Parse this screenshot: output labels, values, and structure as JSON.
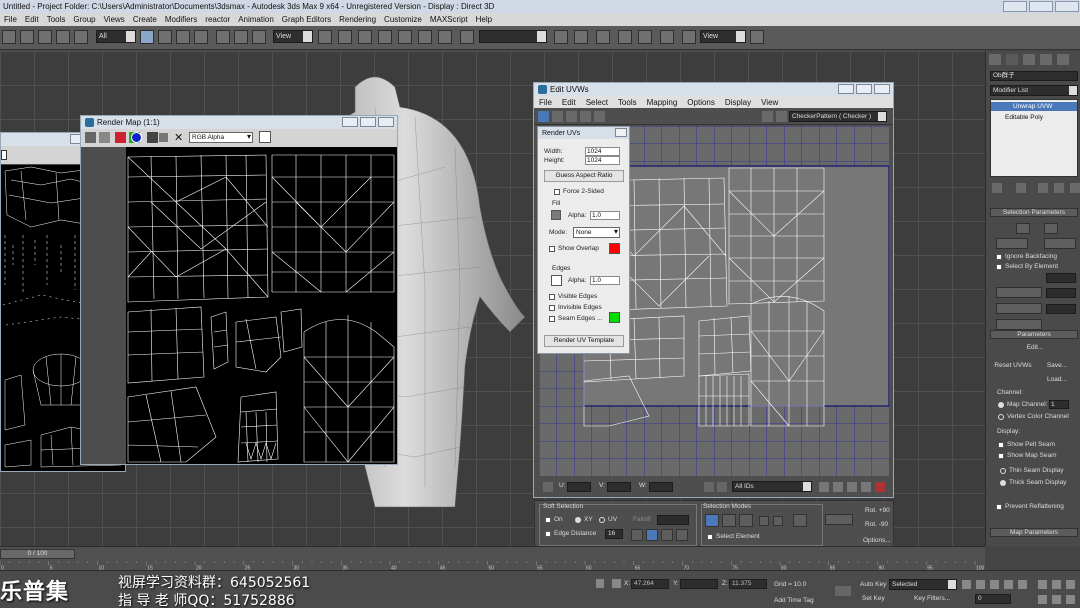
{
  "titlebar": {
    "text": "Untitled      - Project Folder: C:\\Users\\Administrator\\Documents\\3dsmax      - Autodesk 3ds Max 9 x64    - Unregistered Version      - Display : Direct 3D"
  },
  "menubar": [
    "File",
    "Edit",
    "Tools",
    "Group",
    "Views",
    "Create",
    "Modifiers",
    "reactor",
    "Animation",
    "Graph Editors",
    "Rendering",
    "Customize",
    "MAXScript",
    "Help"
  ],
  "toolbar": {
    "selection_filter": "All",
    "ref_coord": "View",
    "named_set": "",
    "view_dropdown": "View"
  },
  "render_map": {
    "title": "Render Map (1:1)",
    "channel": "RGB Alpha"
  },
  "edit_uvws": {
    "title": "Edit UVWs",
    "menu": [
      "File",
      "Edit",
      "Select",
      "Tools",
      "Mapping",
      "Options",
      "Display",
      "View"
    ],
    "map_dropdown": "CheckerPattern  ( Checker )",
    "status": {
      "u_label": "U:",
      "v_label": "V:",
      "w_label": "W:",
      "ids": "All IDs"
    }
  },
  "render_uvs": {
    "title": "Render UVs",
    "width_label": "Width:",
    "width": "1024",
    "height_label": "Height:",
    "height": "1024",
    "guess_aspect": "Guess Aspect Ratio",
    "force_2sided": "Force 2-Sided",
    "fill_header": "Fill",
    "alpha_label": "Alpha:",
    "fill_alpha": "1.0",
    "mode_label": "Mode:",
    "mode": "None",
    "show_overlap": "Show Overlap",
    "edges_header": "Edges",
    "edge_alpha": "1.0",
    "visible_edges": "Visible Edges",
    "invisible_edges": "Invisible Edges",
    "seam_edges": "Seam Edges ...",
    "render_template": "Render UV Template",
    "colors": {
      "fill": "#7a7a7a",
      "overlap": "#ff0000",
      "edge": "#ffffff",
      "seam": "#00e000"
    }
  },
  "uvw_bottom": {
    "soft_selection": "Soft Selection",
    "on": "On",
    "xy": "XY",
    "uv": "UV",
    "falloff": "Falloff",
    "edge_distance": "Edge Distance",
    "edge_distance_value": "16",
    "selection_modes": "Selection Modes",
    "select_element": "Select Element",
    "rot_plus": "Rot. +90",
    "rot_minus": "Rot. -90",
    "options": "Options..."
  },
  "command_panel": {
    "object_name": "Ob群子",
    "modifier_list": "Modifier List",
    "stack": [
      "Unwrap UVW",
      "Editable Poly"
    ],
    "selection_params": "Selection Parameters",
    "ignore_backfacing": "Ignore Backfacing",
    "select_by_element": "Select By Element",
    "parameters": "Parameters",
    "edit": "Edit...",
    "reset_uvws": "Reset UVWs",
    "save": "Save...",
    "load": "Load...",
    "channel": "Channel:",
    "map_channel": "Map Channel:",
    "map_channel_value": "1",
    "vertex_color_channel": "Vertex Color Channel",
    "display": "Display:",
    "show_pelt_seam": "Show Pelt Seam",
    "show_map_seam": "Show Map Seam",
    "thin_seam": "Thin Seam Display",
    "thick_seam": "Thick Seam Display",
    "prevent_reflattening": "Prevent Reflattening",
    "map_parameters": "Map Parameters"
  },
  "timeline": {
    "frame": "0 / 100",
    "ticks": [
      "0",
      "5",
      "10",
      "15",
      "20",
      "25",
      "30",
      "35",
      "40",
      "45",
      "50",
      "55",
      "60",
      "65",
      "70",
      "75",
      "80",
      "85",
      "90",
      "95",
      "100"
    ]
  },
  "statusbar": {
    "x_label": "X:",
    "x": "47.264",
    "y_label": "Y:",
    "y": "",
    "z_label": "Z:",
    "z": "11.375",
    "grid": "Grid = 10.0",
    "add_time_tag": "Add Time Tag",
    "auto_key": "Auto Key",
    "selected": "Selected",
    "set_key": "Set Key",
    "key_filters": "Key Filters...",
    "frame_value": "0"
  },
  "watermark": {
    "logo": "乐普集",
    "line1": "视屏学习资料群：645052561",
    "line2": "指 导 老 师QQ：51752886"
  }
}
